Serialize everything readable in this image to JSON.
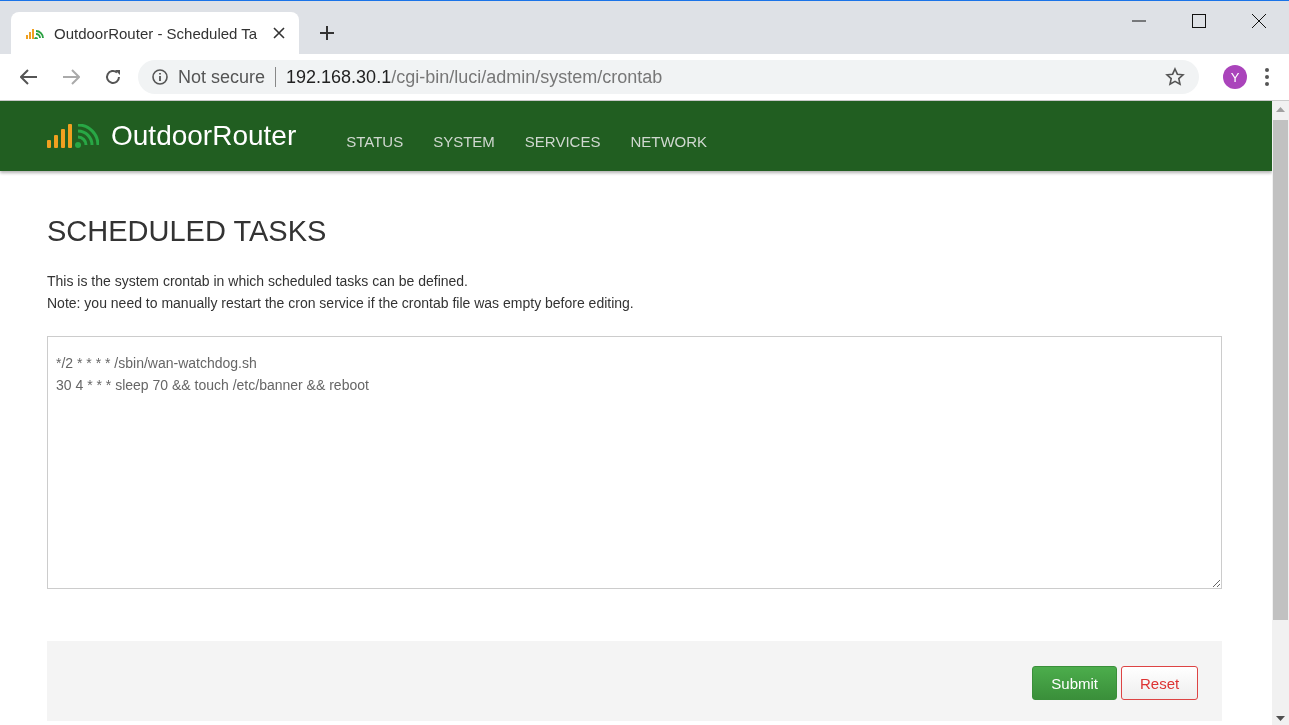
{
  "browser": {
    "tab_title": "OutdoorRouter - Scheduled Ta",
    "security": "Not secure",
    "url_host": "192.168.30.1",
    "url_path": "/cgi-bin/luci/admin/system/crontab",
    "profile_initial": "Y"
  },
  "header": {
    "brand": "OutdoorRouter",
    "menu": [
      {
        "label": "STATUS"
      },
      {
        "label": "SYSTEM"
      },
      {
        "label": "SERVICES"
      },
      {
        "label": "NETWORK"
      }
    ]
  },
  "page": {
    "title": "SCHEDULED TASKS",
    "description": [
      "This is the system crontab in which scheduled tasks can be defined.",
      "Note: you need to manually restart the cron service if the crontab file was empty before editing."
    ],
    "crontab_lines": [
      "*/2 * * * * /sbin/wan-watchdog.sh",
      "30 4 * * * sleep 70 && touch /etc/banner && reboot"
    ],
    "buttons": [
      {
        "label": "Submit",
        "kind": "submit"
      },
      {
        "label": "Reset",
        "kind": "reset"
      }
    ]
  }
}
